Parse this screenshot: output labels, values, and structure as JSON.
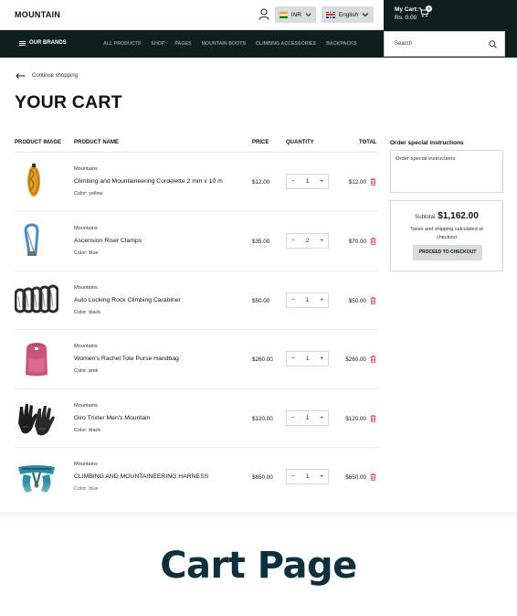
{
  "header": {
    "logo": "MOUNTAIN",
    "currency": "INR",
    "language": "English",
    "cart_label": "My Cart:",
    "cart_total": "Rs. 0.00",
    "cart_count": "0"
  },
  "nav": {
    "brands": "OUR BRANDS",
    "items": [
      "ALL PRODUCTS",
      "SHOP",
      "PAGES",
      "MOUNTAIN BOOTS",
      "CLIMBING ACCESSORIES",
      "BACKPACKS"
    ],
    "search_placeholder": "Search"
  },
  "page": {
    "continue": "Continue shopping",
    "title": "YOUR CART"
  },
  "table": {
    "headers": {
      "image": "PRODUCT IMAGE",
      "name": "PRODUCT NAME",
      "price": "PRICE",
      "quantity": "QUANTITY",
      "total": "TOTAL"
    },
    "rows": [
      {
        "vendor": "Mountains",
        "name": "Climbing and Mountaineering Cordelette 2 mm x 10 m",
        "color": "Color: yellow",
        "price": "$12.00",
        "qty": "1",
        "total": "$12.00",
        "image": "rope-coil"
      },
      {
        "vendor": "Mountains",
        "name": "Ascension Riser Clamps",
        "color": "Color: blue",
        "price": "$35.00",
        "qty": "2",
        "total": "$70.00",
        "image": "carabiner-clamp"
      },
      {
        "vendor": "Mountains",
        "name": "Auto Locking Rock Climbing Carabiner",
        "color": "Color: black",
        "price": "$50.00",
        "qty": "1",
        "total": "$50.00",
        "image": "carabiner-set"
      },
      {
        "vendor": "Mountains",
        "name": "Women's Rachel Tote Purse Handbag",
        "color": "Color: pink",
        "price": "$260.00",
        "qty": "1",
        "total": "$260.00",
        "image": "pink-backpack"
      },
      {
        "vendor": "Mountains",
        "name": "Giro Trixter Men's Mountain",
        "color": "Color: black",
        "price": "$120.00",
        "qty": "1",
        "total": "$120.00",
        "image": "gloves"
      },
      {
        "vendor": "Mountains",
        "name": "CLIMBING AND MOUNTAINEERING HARNESS",
        "color": "Color: blue",
        "price": "$650.00",
        "qty": "1",
        "total": "$650.00",
        "image": "harness"
      }
    ]
  },
  "sidebar": {
    "instructions_title": "Order special instructions",
    "instructions_placeholder": "Order special instructions",
    "subtotal_label": "Subtotal",
    "subtotal_value": "$1,162.00",
    "taxes_note": "Taxes and shipping calculated at checkout",
    "checkout_label": "PROCEED TO CHECKOUT"
  },
  "caption": "Cart Page",
  "colors": {
    "dark": "#0f1f1e",
    "caption": "#0e2f3d",
    "delete": "#e0404a",
    "button": "#d8dcdc"
  }
}
